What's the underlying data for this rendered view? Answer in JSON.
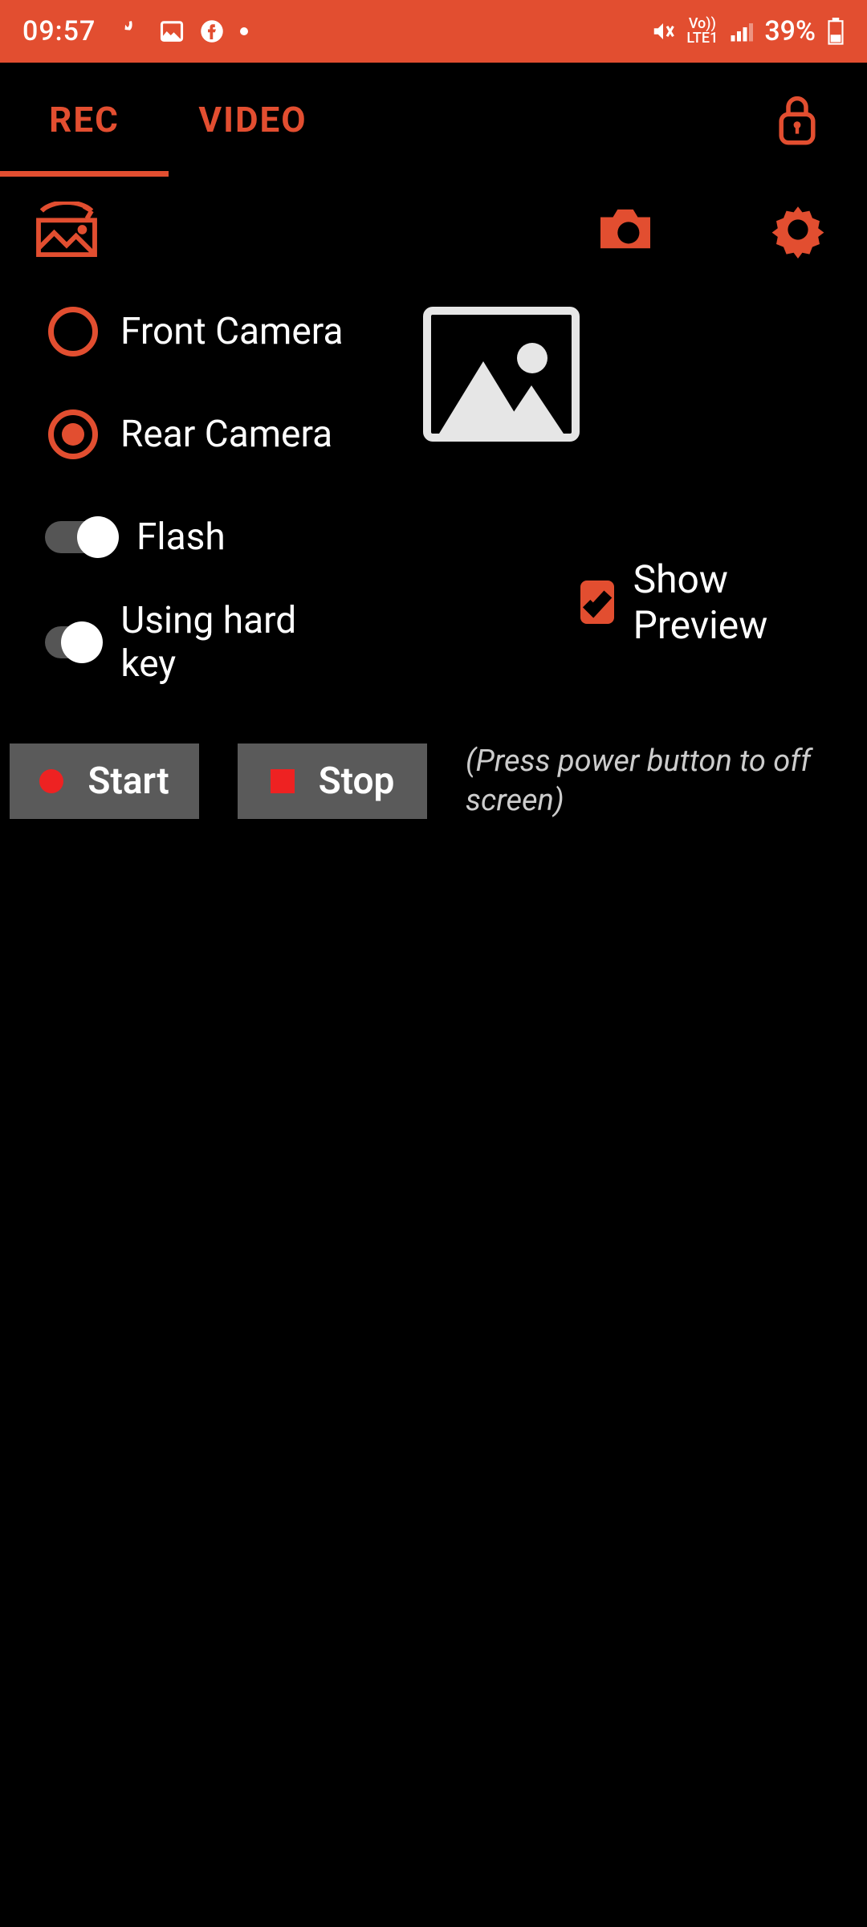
{
  "status": {
    "time": "09:57",
    "network_indicator": "LTE1",
    "volte": "Vo))",
    "battery": "39%"
  },
  "tabs": {
    "rec": "REC",
    "video": "VIDEO",
    "active": "rec"
  },
  "camera_options": {
    "front": "Front Camera",
    "rear": "Rear Camera"
  },
  "toggles": {
    "flash": "Flash",
    "hardkey": "Using hard key"
  },
  "checkbox": {
    "show_preview": "Show Preview"
  },
  "buttons": {
    "start": "Start",
    "stop": "Stop"
  },
  "hint": "(Press power button to off screen)"
}
